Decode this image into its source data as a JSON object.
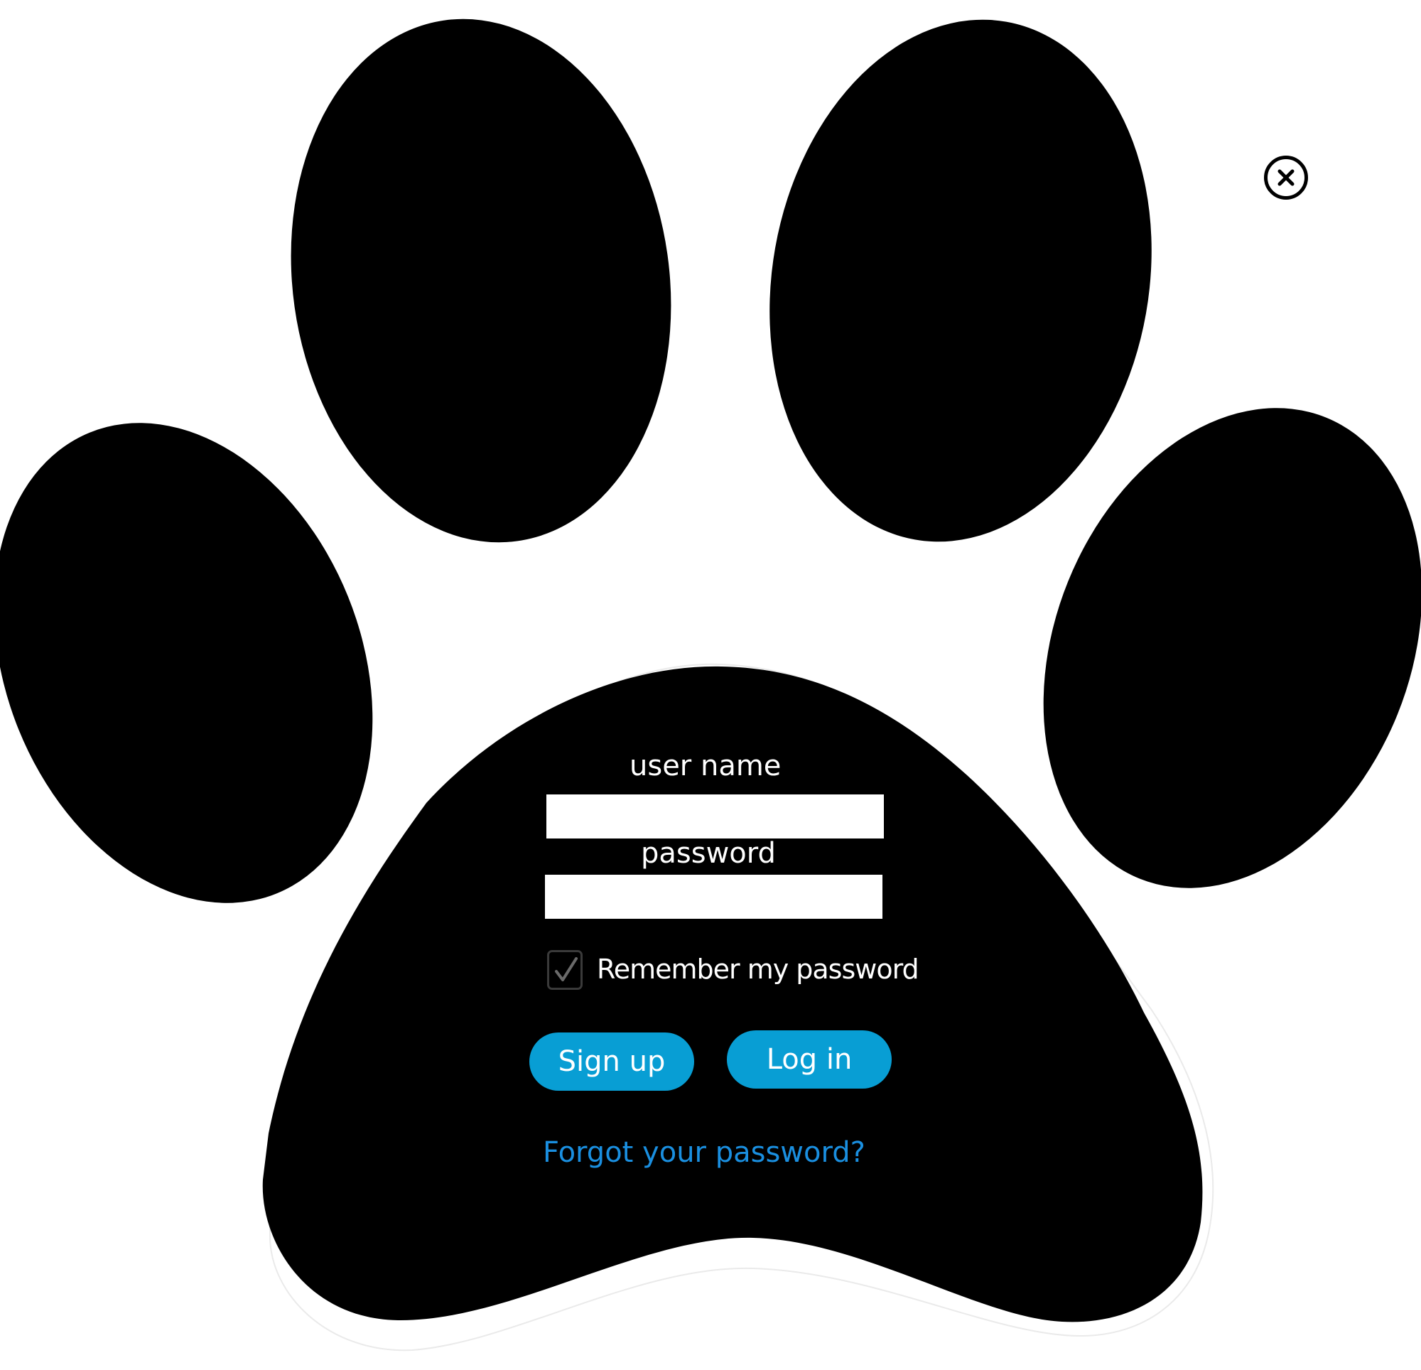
{
  "login": {
    "username_label": "user name",
    "username_value": "",
    "password_label": "password",
    "password_value": "",
    "remember_label": "Remember my password",
    "remember_checked": true,
    "signup_label": "Sign up",
    "login_label": "Log in",
    "forgot_label": "Forgot your password?"
  },
  "icons": {
    "close": "close-circle-icon",
    "check": "checkmark-icon"
  },
  "colors": {
    "paw": "#000000",
    "background": "#ffffff",
    "button": "#089ed4",
    "link": "#1a8fe0",
    "label_text": "#ffffff"
  }
}
